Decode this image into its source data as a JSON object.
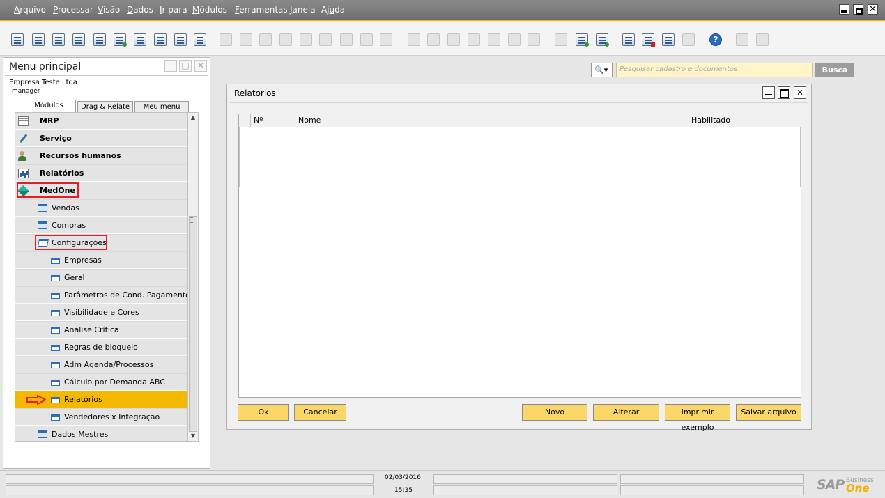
{
  "menubar": {
    "items": [
      {
        "pre": "",
        "u": "A",
        "post": "rquivo"
      },
      {
        "pre": "",
        "u": "P",
        "post": "rocessar"
      },
      {
        "pre": "",
        "u": "V",
        "post": "isão"
      },
      {
        "pre": "",
        "u": "D",
        "post": "ados"
      },
      {
        "pre": "",
        "u": "I",
        "post": "r para"
      },
      {
        "pre": "",
        "u": "M",
        "post": "ódulos"
      },
      {
        "pre": "",
        "u": "F",
        "post": "erramentas"
      },
      {
        "pre": "",
        "u": "J",
        "post": "anela"
      },
      {
        "pre": "Aj",
        "u": "u",
        "post": "da"
      }
    ],
    "window_close": "✕"
  },
  "left_panel": {
    "title": "Menu principal",
    "btn_min": "_",
    "btn_max": "□",
    "btn_close": "✕",
    "company": "Empresa Teste Ltda",
    "user": "manager",
    "tabs": [
      "Módulos",
      "Drag & Relate",
      "Meu menu"
    ],
    "tree": [
      {
        "label": "MRP"
      },
      {
        "label": "Serviço"
      },
      {
        "label": "Recursos humanos"
      },
      {
        "label": "Relatórios"
      },
      {
        "label": "MedOne"
      },
      {
        "label": "Vendas"
      },
      {
        "label": "Compras"
      },
      {
        "label": "Configurações"
      },
      {
        "label": "Empresas"
      },
      {
        "label": "Geral"
      },
      {
        "label": "Parâmetros de Cond. Pagamento"
      },
      {
        "label": "Visibilidade e Cores"
      },
      {
        "label": "Analise Crítica"
      },
      {
        "label": "Regras de bloqueio"
      },
      {
        "label": "Adm Agenda/Processos"
      },
      {
        "label": "Cálculo por Demanda ABC"
      },
      {
        "label": "Relatórios"
      },
      {
        "label": "Vendedores x Integração"
      },
      {
        "label": "Dados Mestres"
      }
    ],
    "scroll_up": "▲",
    "scroll_down": "▼"
  },
  "search": {
    "icon": "🔍▾",
    "placeholder": "Pesquisar cadastro e documentos",
    "button": "Busca"
  },
  "dialog": {
    "title": "Relatorios",
    "btn_close": "✕",
    "columns": [
      "Nº",
      "Nome",
      "Habilitado"
    ],
    "buttons": {
      "ok": "Ok",
      "cancel": "Cancelar",
      "new": "Novo",
      "edit": "Alterar",
      "print_sample": "Imprimir exemplo",
      "save_file": "Salvar arquivo"
    }
  },
  "status": {
    "date": "02/03/2016",
    "time": "15:35",
    "logo_sap": "SAP",
    "logo_business": "Business",
    "logo_one": "One"
  },
  "colors": {
    "selected_row": "#f5b800",
    "highlight_box": "#e41e26",
    "button": "#fbd76a",
    "search_field": "#fff5c8"
  }
}
